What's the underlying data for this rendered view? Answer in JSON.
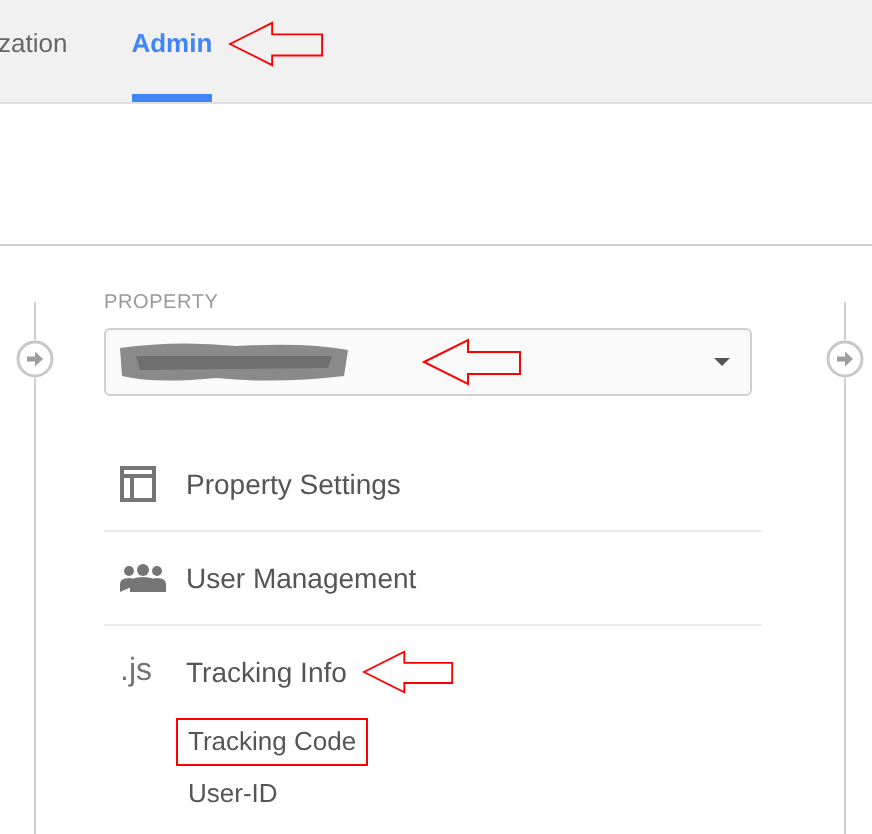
{
  "tabs": [
    {
      "label": "zation",
      "selected": false,
      "marked": false
    },
    {
      "label": "Admin",
      "selected": true,
      "marked": true
    }
  ],
  "property": {
    "label": "PROPERTY",
    "redacted": true,
    "marked": true
  },
  "menu": [
    {
      "kind": "panel",
      "label": "Property Settings",
      "marked": false
    },
    {
      "kind": "people",
      "label": "User Management",
      "marked": false
    },
    {
      "kind": "js",
      "icon_text": ".js",
      "label": "Tracking Info",
      "marked": true,
      "children": [
        {
          "label": "Tracking Code",
          "highlighted": true
        },
        {
          "label": "User-ID",
          "highlighted": false
        }
      ]
    }
  ]
}
